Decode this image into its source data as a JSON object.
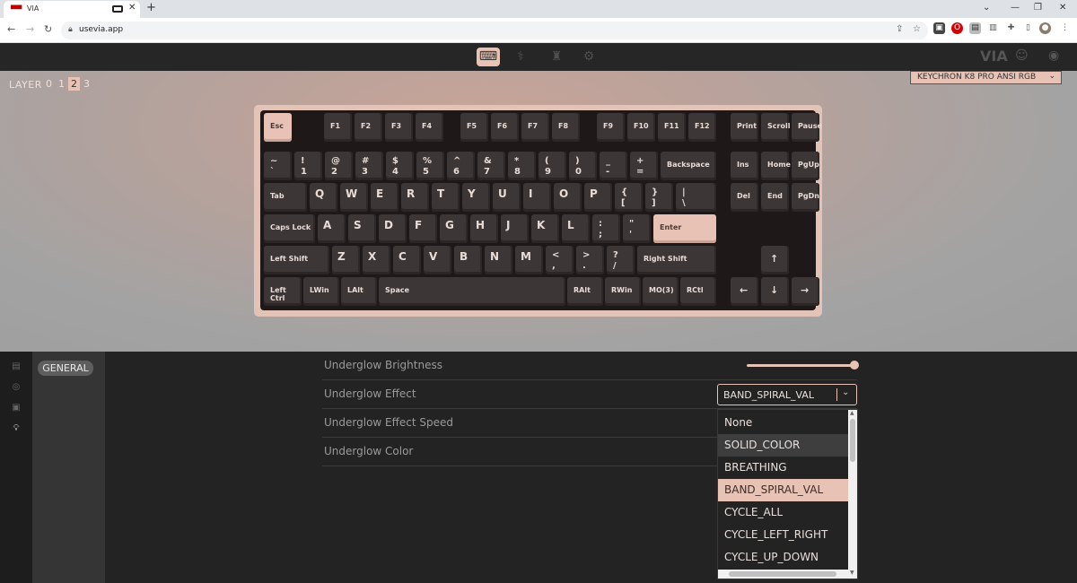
{
  "browser": {
    "tab_title": "VIA",
    "url": "usevia.app"
  },
  "toolbar": {
    "via_logo": "VIA"
  },
  "layers": {
    "label": "LAYER",
    "items": [
      "0",
      "1",
      "2",
      "3"
    ],
    "active": "2"
  },
  "keyboard_select": {
    "value": "KEYCHRON K8 PRO ANSI RGB"
  },
  "keys": {
    "esc": "Esc",
    "f1": "F1",
    "f2": "F2",
    "f3": "F3",
    "f4": "F4",
    "f5": "F5",
    "f6": "F6",
    "f7": "F7",
    "f8": "F8",
    "f9": "F9",
    "f10": "F10",
    "f11": "F11",
    "f12": "F12",
    "print": "Print",
    "scroll": "Scroll",
    "pause": "Pause",
    "tilde_t": "~",
    "tilde_b": "`",
    "n1_t": "!",
    "n1_b": "1",
    "n2_t": "@",
    "n2_b": "2",
    "n3_t": "#",
    "n3_b": "3",
    "n4_t": "$",
    "n4_b": "4",
    "n5_t": "%",
    "n5_b": "5",
    "n6_t": "^",
    "n6_b": "6",
    "n7_t": "&",
    "n7_b": "7",
    "n8_t": "*",
    "n8_b": "8",
    "n9_t": "(",
    "n9_b": "9",
    "n0_t": ")",
    "n0_b": "0",
    "minus_t": "_",
    "minus_b": "-",
    "eq_t": "+",
    "eq_b": "=",
    "backspace": "Backspace",
    "ins": "Ins",
    "home": "Home",
    "pgup": "PgUp",
    "tab": "Tab",
    "q": "Q",
    "w": "W",
    "e": "E",
    "r": "R",
    "t": "T",
    "y": "Y",
    "u": "U",
    "i": "I",
    "o": "O",
    "p": "P",
    "lbr_t": "{",
    "lbr_b": "[",
    "rbr_t": "}",
    "rbr_b": "]",
    "bs_t": "|",
    "bs_b": "\\",
    "del": "Del",
    "end": "End",
    "pgdn": "PgDn",
    "caps": "Caps Lock",
    "a": "A",
    "s": "S",
    "d": "D",
    "f": "F",
    "g": "G",
    "h": "H",
    "j": "J",
    "k": "K",
    "l": "L",
    "semi_t": ":",
    "semi_b": ";",
    "quote_t": "\"",
    "quote_b": "'",
    "enter": "Enter",
    "lshift": "Left Shift",
    "z": "Z",
    "x": "X",
    "c": "C",
    "v": "V",
    "b": "B",
    "n": "N",
    "m": "M",
    "comma_t": "<",
    "comma_b": ",",
    "dot_t": ">",
    "dot_b": ".",
    "slash_t": "?",
    "slash_b": "/",
    "rshift": "Right Shift",
    "up": "↑",
    "lctrl": "Left Ctrl",
    "lwin": "LWin",
    "lalt": "LAlt",
    "space": "Space",
    "ralt": "RAlt",
    "rwin": "RWin",
    "mo3": "MO(3)",
    "rctl": "RCtl",
    "left": "←",
    "down": "↓",
    "right": "→"
  },
  "sidebar": {
    "general_label": "GENERAL"
  },
  "settings": {
    "brightness_label": "Underglow Brightness",
    "brightness_value": 1.0,
    "effect_label": "Underglow Effect",
    "effect_value": "BAND_SPIRAL_VAL",
    "speed_label": "Underglow Effect Speed",
    "color_label": "Underglow Color"
  },
  "dropdown": {
    "options": [
      "None",
      "SOLID_COLOR",
      "BREATHING",
      "BAND_SPIRAL_VAL",
      "CYCLE_ALL",
      "CYCLE_LEFT_RIGHT",
      "CYCLE_UP_DOWN"
    ],
    "hovered": "SOLID_COLOR",
    "selected": "BAND_SPIRAL_VAL"
  },
  "colors": {
    "accent": "#e8c3b5",
    "keycap": "#3d3636",
    "background": "#232323"
  }
}
